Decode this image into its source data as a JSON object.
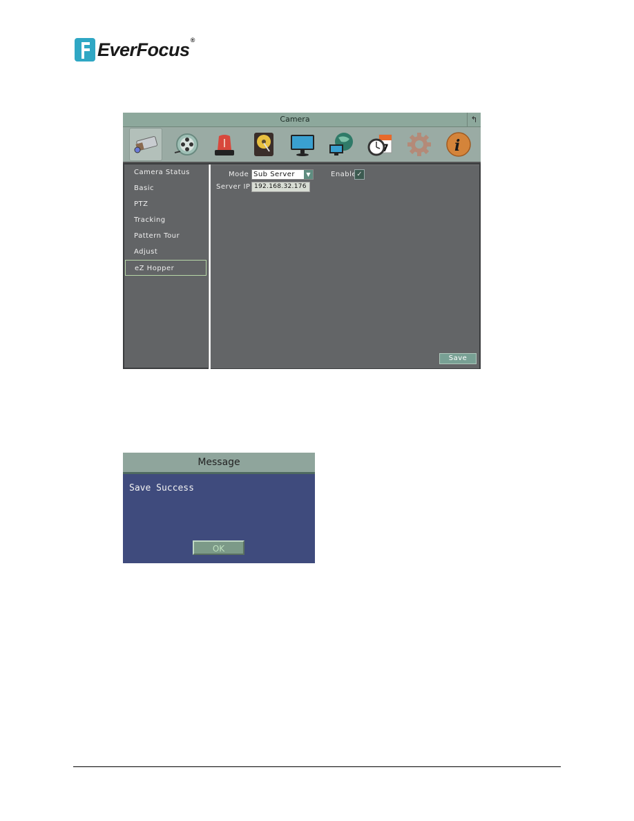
{
  "brand": {
    "name": "EverFocus",
    "registered": "®"
  },
  "window": {
    "title": "Camera",
    "back_icon": "back-arrow-icon",
    "toolbar_icons": [
      {
        "name": "camera-icon",
        "active": true
      },
      {
        "name": "record-reel-icon",
        "active": false
      },
      {
        "name": "alarm-siren-icon",
        "active": false
      },
      {
        "name": "hard-disk-icon",
        "active": false
      },
      {
        "name": "monitor-icon",
        "active": false
      },
      {
        "name": "network-globe-icon",
        "active": false
      },
      {
        "name": "schedule-clock-calendar-icon",
        "active": false
      },
      {
        "name": "settings-gear-icon",
        "active": false
      },
      {
        "name": "info-icon",
        "active": false
      }
    ],
    "sidebar": {
      "items": [
        {
          "label": "Camera Status"
        },
        {
          "label": "Basic"
        },
        {
          "label": "PTZ"
        },
        {
          "label": "Tracking"
        },
        {
          "label": "Pattern Tour"
        },
        {
          "label": "Adjust"
        },
        {
          "label": "eZ Hopper",
          "active": true
        }
      ]
    },
    "form": {
      "mode_label": "Mode",
      "mode_value": "Sub Server",
      "enable_label": "Enable",
      "enable_checked": true,
      "server_ip_label": "Server IP",
      "server_ip_value": "192.168.32.176",
      "save_label": "Save"
    }
  },
  "dialog": {
    "title": "Message",
    "text": "Save Success",
    "ok_label": "OK"
  },
  "colors": {
    "titlebar": "#8da89c",
    "panel": "#636567",
    "dialog_bg": "#3f4b7d",
    "accent_green": "#78a094"
  }
}
